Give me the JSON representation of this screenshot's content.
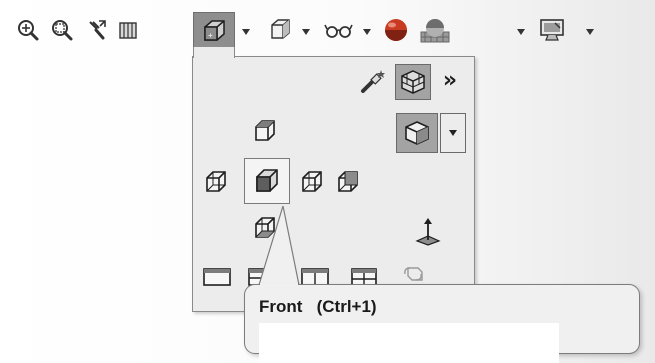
{
  "toolbar": {
    "items": [
      {
        "icon": "zoom-to-fit-icon"
      },
      {
        "icon": "zoom-to-area-icon"
      },
      {
        "icon": "previous-view-icon"
      },
      {
        "icon": "section-view-icon"
      },
      {
        "icon": "view-orientation-icon",
        "active": true,
        "has_dropdown": true
      },
      {
        "icon": "display-style-icon",
        "has_dropdown": true
      },
      {
        "icon": "hide-show-items-icon",
        "has_dropdown": true
      },
      {
        "icon": "edit-appearance-icon"
      },
      {
        "icon": "apply-scene-icon",
        "has_dropdown": true
      },
      {
        "icon": "view-settings-icon",
        "has_dropdown": true
      }
    ],
    "colors": {
      "active_bg": "#8e8e8e",
      "icon_dark": "#2b2b2b",
      "sphere_red": "#d23a1f",
      "sphere_blue": "#3552a8"
    }
  },
  "view_menu": {
    "top_row": {
      "buttons": [
        {
          "icon": "new-view-wand-icon"
        },
        {
          "icon": "view-selector-icon",
          "pressed": true
        },
        {
          "icon": "expand-chevrons-icon",
          "label": "»"
        }
      ]
    },
    "views": [
      {
        "icon": "top-view-icon"
      },
      {
        "icon": "isometric-view-icon",
        "pressed": true,
        "has_dropdown": true
      },
      {
        "icon": "left-view-icon"
      },
      {
        "icon": "front-view-icon",
        "hovered": true
      },
      {
        "icon": "right-view-icon"
      },
      {
        "icon": "back-view-icon"
      },
      {
        "icon": "bottom-view-icon"
      },
      {
        "icon": "normal-to-icon"
      },
      {
        "icon": "single-view-icon"
      },
      {
        "icon": "two-view-horizontal-icon"
      },
      {
        "icon": "two-view-vertical-icon"
      },
      {
        "icon": "four-view-icon"
      },
      {
        "icon": "link-views-icon"
      }
    ]
  },
  "tooltip": {
    "title": "Front",
    "shortcut": "(Ctrl+1)"
  }
}
